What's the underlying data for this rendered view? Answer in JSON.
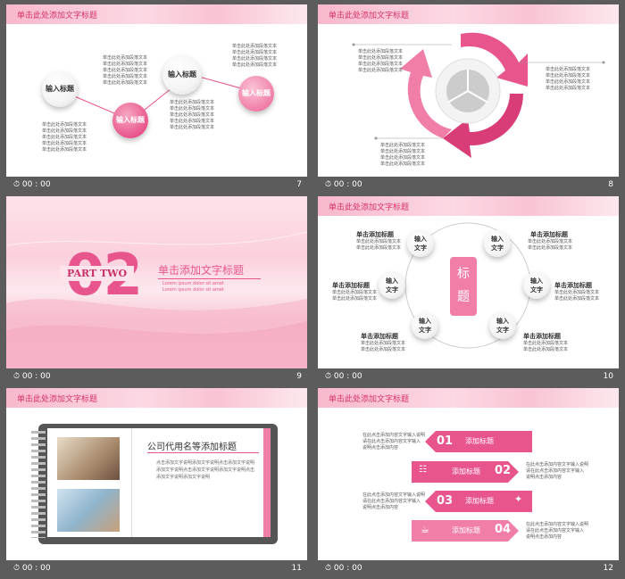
{
  "colors": {
    "accent": "#e8558c",
    "header_text": "#d6336c",
    "background": "#5c5c5c"
  },
  "slides": [
    {
      "num": "7",
      "time": "00 : 00",
      "header": "单击此处添加文字标题",
      "labels": [
        "输入标题",
        "输入标题",
        "输入标题",
        "输入标题"
      ],
      "text_block": "单击此处添加段落文本"
    },
    {
      "num": "8",
      "time": "00 : 00",
      "header": "单击此处添加文字标题",
      "text_block": "单击此处添加段落文本"
    },
    {
      "num": "9",
      "time": "00 : 00",
      "big": "02",
      "part": "PART TWO",
      "title": "单击添加文字标题",
      "lorem": "Lorem ipsum dolor sit amet"
    },
    {
      "num": "10",
      "time": "00 : 00",
      "header": "单击此处添加文字标题",
      "center": "标\n题",
      "node": "输入\n文字",
      "subtitle": "单击添加标题",
      "text_block": "单击此处添加段落文本"
    },
    {
      "num": "11",
      "time": "00 : 00",
      "header": "单击此处添加文字标题",
      "book_title": "公司代用名等添加标题",
      "para": "点击添加文字说明添加文字说明点击添加文字说明添加文字说明点击添加文字说明添加文字说明点击添加文字说明添加文字说明"
    },
    {
      "num": "12",
      "time": "00 : 00",
      "header": "单击此处添加文字标题",
      "arrows": [
        {
          "n": "01",
          "label": "添加标题"
        },
        {
          "n": "02",
          "label": "添加标题"
        },
        {
          "n": "03",
          "label": "添加标题"
        },
        {
          "n": "04",
          "label": "添加标题"
        }
      ],
      "side_text": "在此点击添加内容文字输入说明\n请在此点击添加内容文字输入\n说明点击添加内容"
    }
  ]
}
